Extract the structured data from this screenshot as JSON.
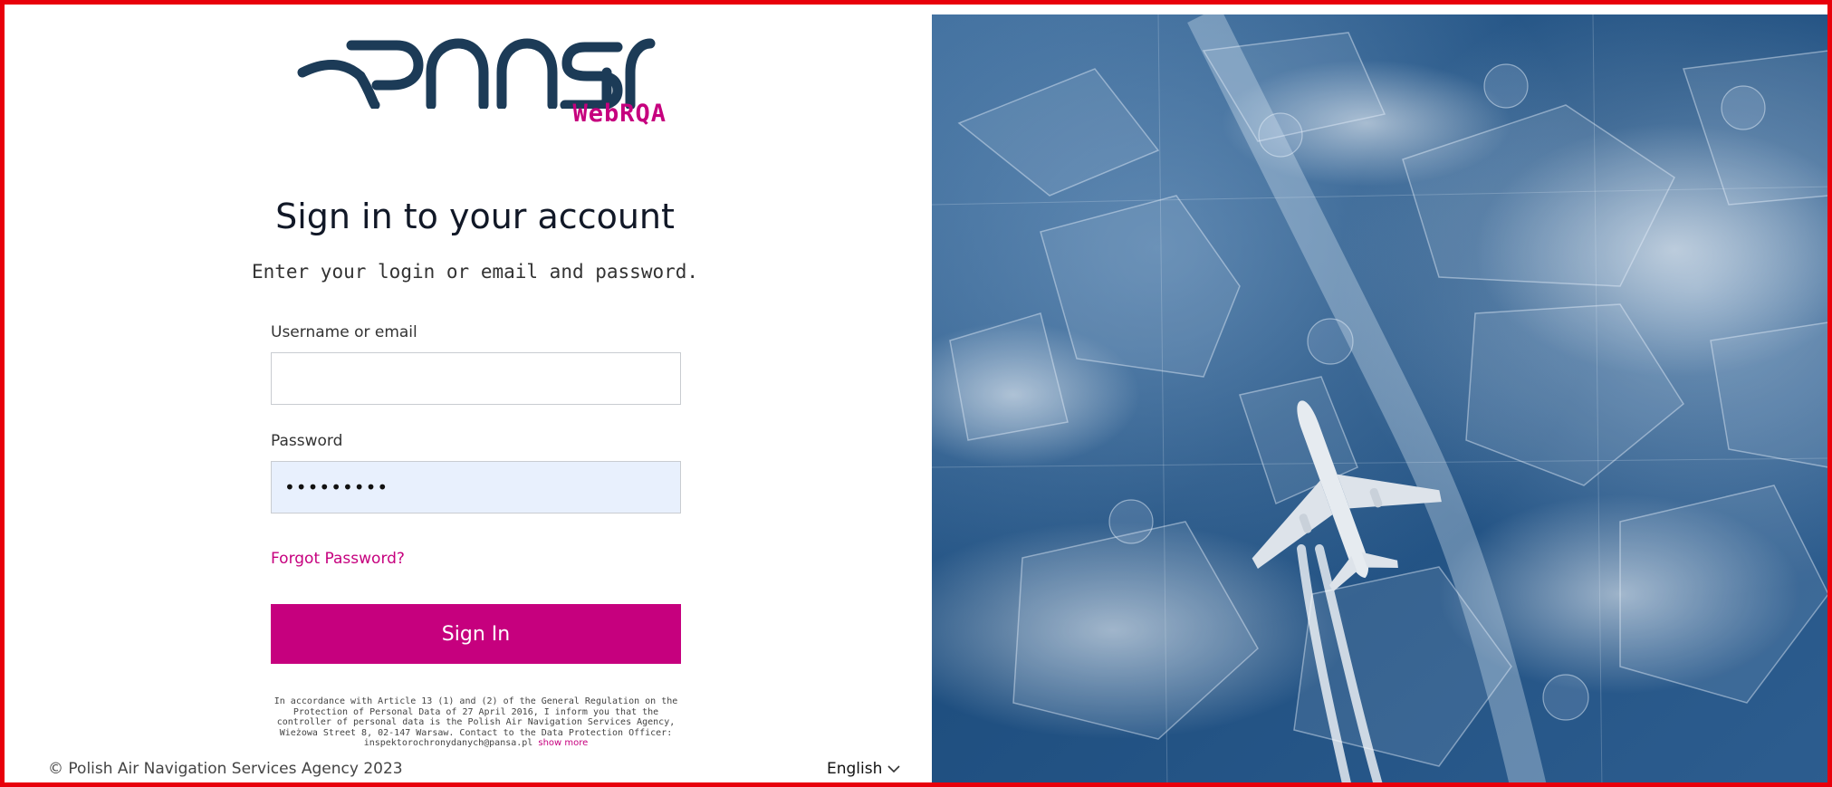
{
  "brand": {
    "logo_text": "PANSA",
    "product": "WebRQA",
    "color_primary": "#c6007e",
    "color_logo": "#1c3b57"
  },
  "login": {
    "title": "Sign in to your account",
    "subtitle": "Enter your login or email and password.",
    "username_label": "Username or email",
    "username_value": "",
    "password_label": "Password",
    "password_value": "•••••••••",
    "forgot_label": "Forgot Password?",
    "signin_label": "Sign In"
  },
  "legal": {
    "text": "In accordance with Article 13 (1) and (2) of the General Regulation on the Protection of Personal Data of 27 April 2016, I inform you that the controller of personal data is the Polish Air Navigation Services Agency, Wieżowa Street 8, 02-147 Warsaw. Contact to the Data Protection Officer: inspektorochronydanych@pansa.pl",
    "show_more": "show more"
  },
  "footer": {
    "copyright": "© Polish Air Navigation Services Agency 2023",
    "language": "English",
    "language_icon": "chevron-down-icon"
  },
  "hero": {
    "icon": "airplane-illustration"
  }
}
